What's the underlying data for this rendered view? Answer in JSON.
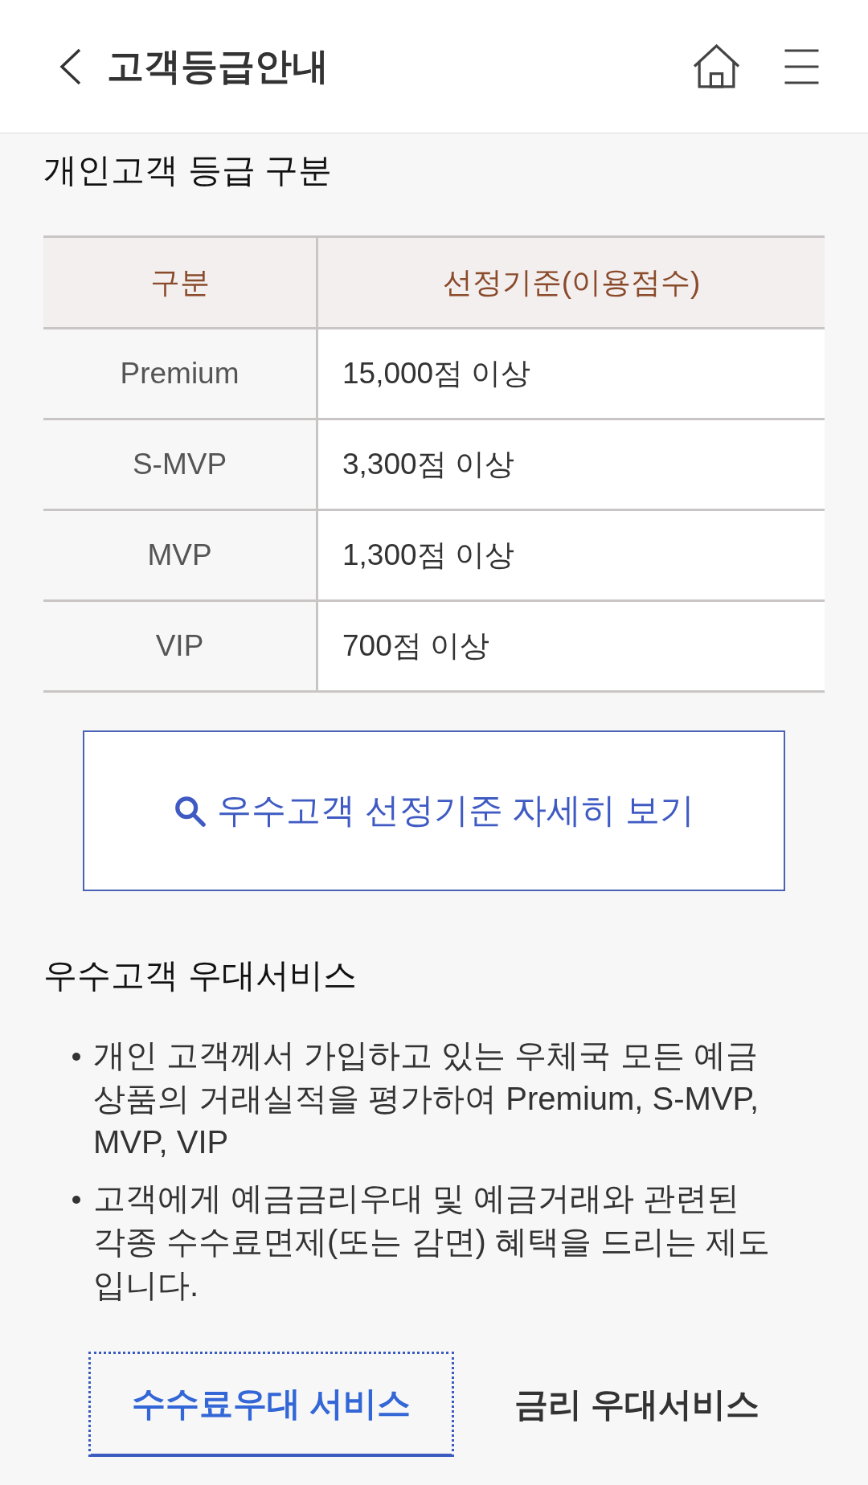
{
  "header": {
    "title": "고객등급안내"
  },
  "grade_section": {
    "title": "개인고객 등급 구분",
    "table": {
      "columns": [
        "구분",
        "선정기준(이용점수)"
      ],
      "rows": [
        [
          "Premium",
          "15,000점 이상"
        ],
        [
          "S-MVP",
          "3,300점 이상"
        ],
        [
          "MVP",
          "1,300점 이상"
        ],
        [
          "VIP",
          "700점 이상"
        ]
      ]
    }
  },
  "detail_button": {
    "label": "우수고객 선정기준 자세히 보기"
  },
  "benefit_section": {
    "title": "우수고객 우대서비스",
    "bullets": [
      "개인 고객께서 가입하고 있는 우체국 모든 예금상품의 거래실적을 평가하여 Premium, S-MVP, MVP, VIP",
      "고객에게 예금금리우대 및 예금거래와 관련된 각종 수수료면제(또는 감면) 혜택을 드리는 제도입니다."
    ],
    "tabs": [
      {
        "label": "수수료우대 서비스",
        "selected": true
      },
      {
        "label": "금리 우대서비스",
        "selected": false
      }
    ]
  }
}
